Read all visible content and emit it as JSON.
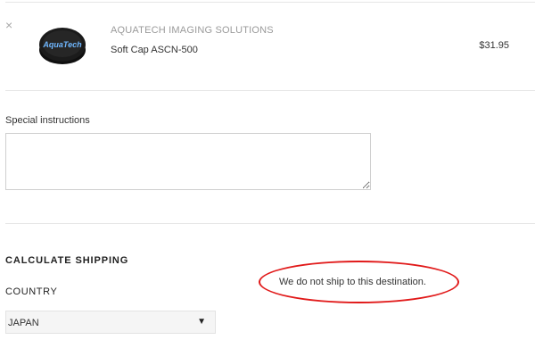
{
  "cart_item": {
    "remove_glyph": "×",
    "vendor": "AQUATECH IMAGING SOLUTIONS",
    "title": "Soft Cap ASCN-500",
    "price": "$31.95",
    "image_logo_text": "AquaTech"
  },
  "special_instructions": {
    "label": "Special instructions",
    "value": ""
  },
  "shipping": {
    "heading": "CALCULATE SHIPPING",
    "country_label": "COUNTRY",
    "country_value": "JAPAN",
    "caret": "▼",
    "message": "We do not ship to this destination."
  }
}
